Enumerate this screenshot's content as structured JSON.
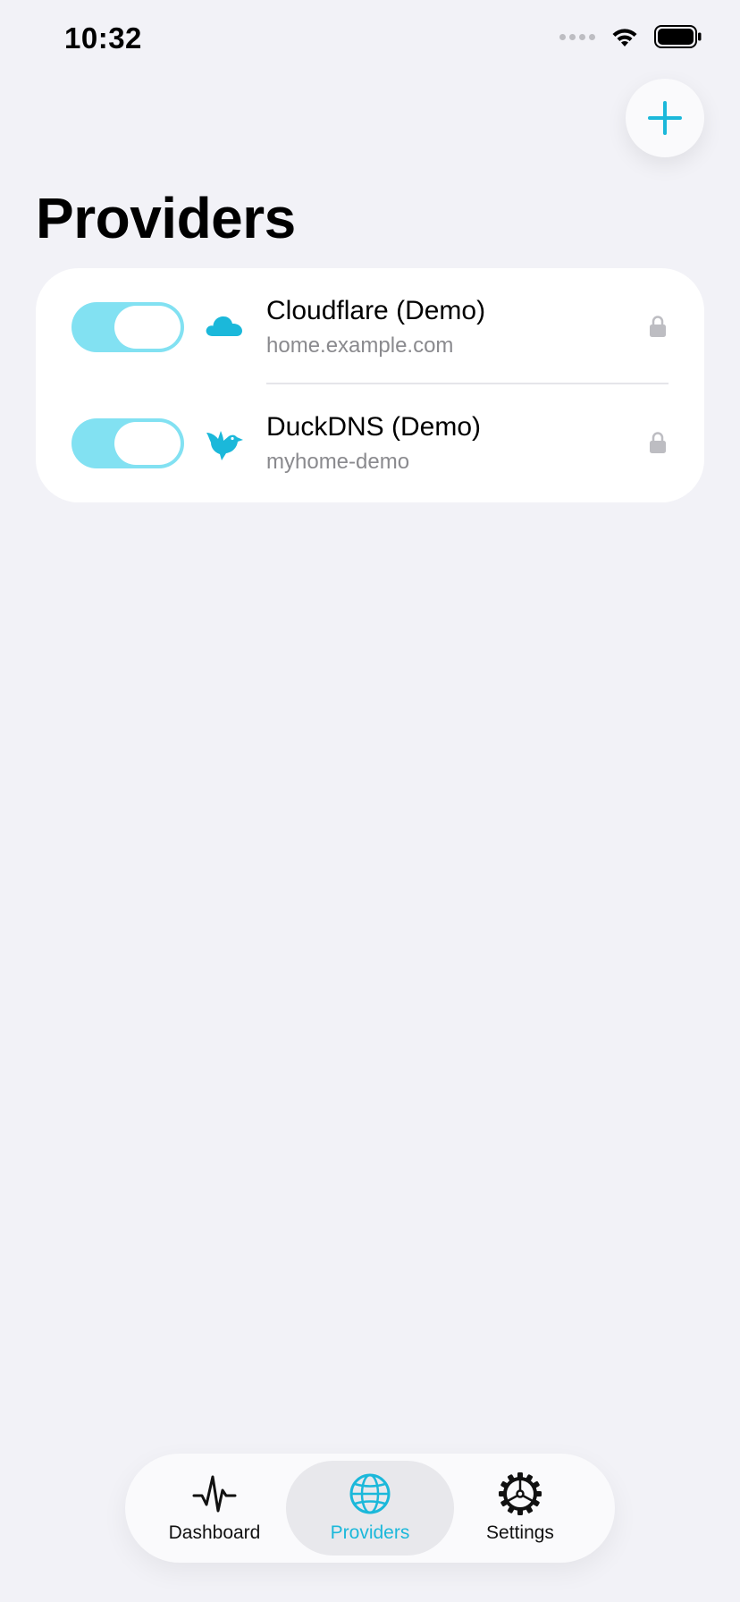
{
  "status_bar": {
    "time": "10:32"
  },
  "header": {
    "title": "Providers",
    "add_button_icon": "plus-icon"
  },
  "colors": {
    "accent": "#1BB8DA",
    "toggle_on": "#82E1F2",
    "background": "#F2F2F7",
    "secondary_text": "#8A8A8E"
  },
  "providers": [
    {
      "name": "Cloudflare (Demo)",
      "subtitle": "home.example.com",
      "enabled": true,
      "icon": "cloud-icon",
      "locked": true
    },
    {
      "name": "DuckDNS (Demo)",
      "subtitle": "myhome-demo",
      "enabled": true,
      "icon": "bird-icon",
      "locked": true
    }
  ],
  "tab_bar": {
    "tabs": [
      {
        "label": "Dashboard",
        "icon": "waveform-icon",
        "selected": false
      },
      {
        "label": "Providers",
        "icon": "globe-icon",
        "selected": true
      },
      {
        "label": "Settings",
        "icon": "gear-icon",
        "selected": false
      }
    ]
  }
}
